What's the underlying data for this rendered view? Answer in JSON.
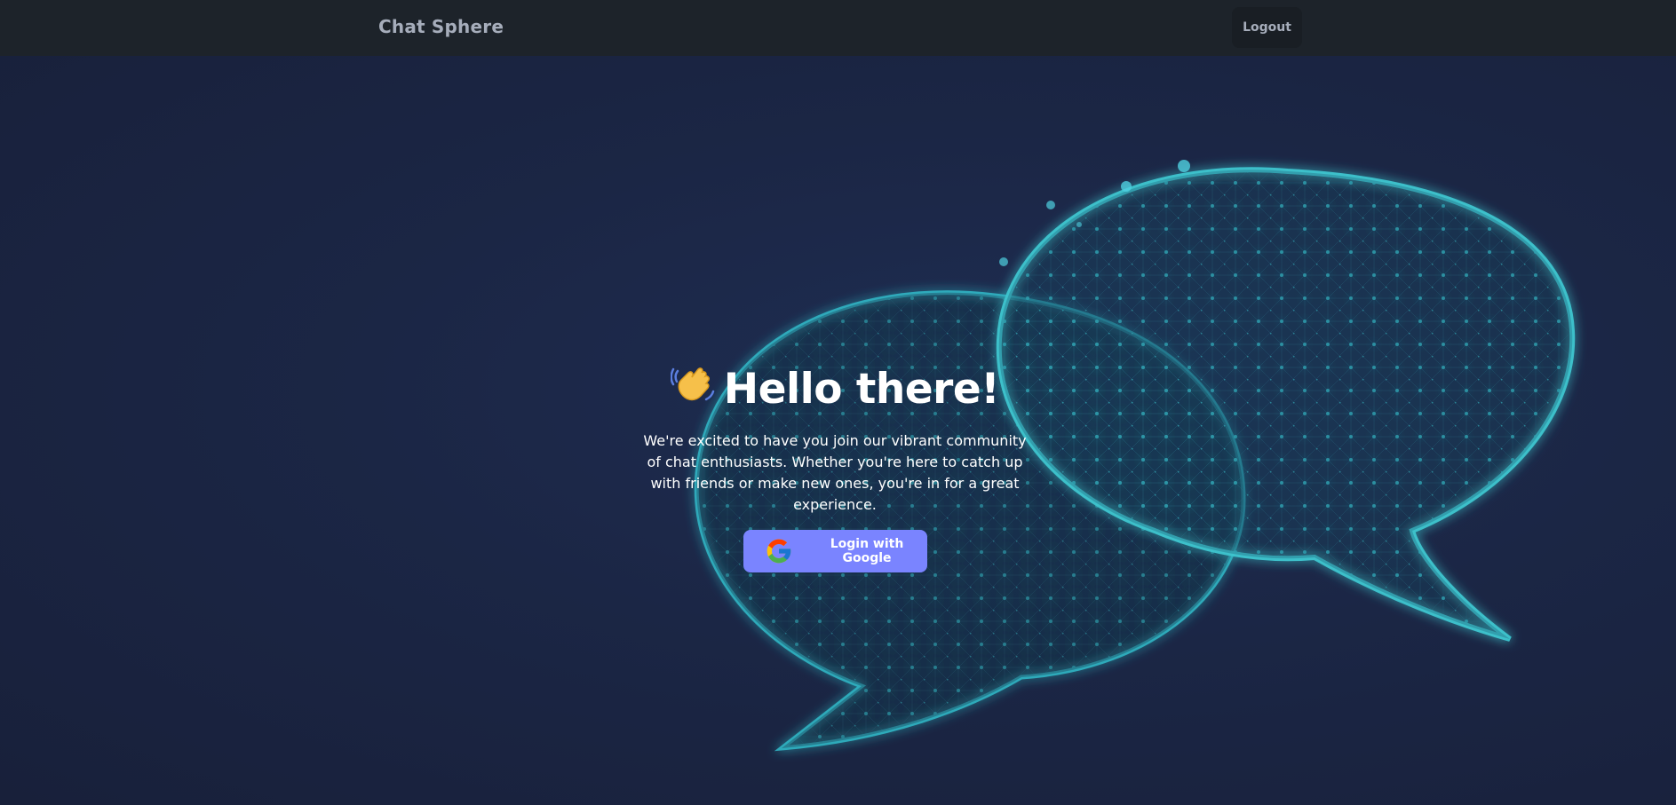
{
  "navbar": {
    "brand": "Chat Sphere",
    "logout_label": "Logout"
  },
  "hero": {
    "title": "Hello there!",
    "description": "We're excited to have you join our vibrant community of chat enthusiasts. Whether you're here to catch up with friends or make new ones, you're in for a great experience.",
    "login_button_label": "Login with Google"
  },
  "icons": {
    "wave": "waving-hand-icon",
    "google": "google-logo-icon"
  },
  "colors": {
    "navbar_bg": "#1d232a",
    "hero_bg": "#1b2645",
    "accent_button": "#7a84ff",
    "bubble_glow": "#2bb5c8"
  }
}
